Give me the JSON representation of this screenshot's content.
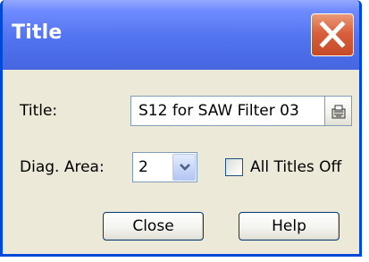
{
  "window": {
    "title": "Title"
  },
  "form": {
    "title_label": "Title:",
    "title_value": "S12 for SAW Filter 03",
    "diag_area_label": "Diag. Area:",
    "diag_area_value": "2",
    "all_titles_off_label": "All Titles Off",
    "all_titles_off_checked": false
  },
  "buttons": {
    "close_label": "Close",
    "help_label": "Help"
  },
  "icons": {
    "window_close": "close-x-icon",
    "title_picker": "picker-icon",
    "dropdown": "chevron-down-icon"
  },
  "colors": {
    "titlebar": "#4666e0",
    "window_border": "#0048d8",
    "close_button": "#d9603c",
    "dialog_background": "#ece9d8"
  }
}
